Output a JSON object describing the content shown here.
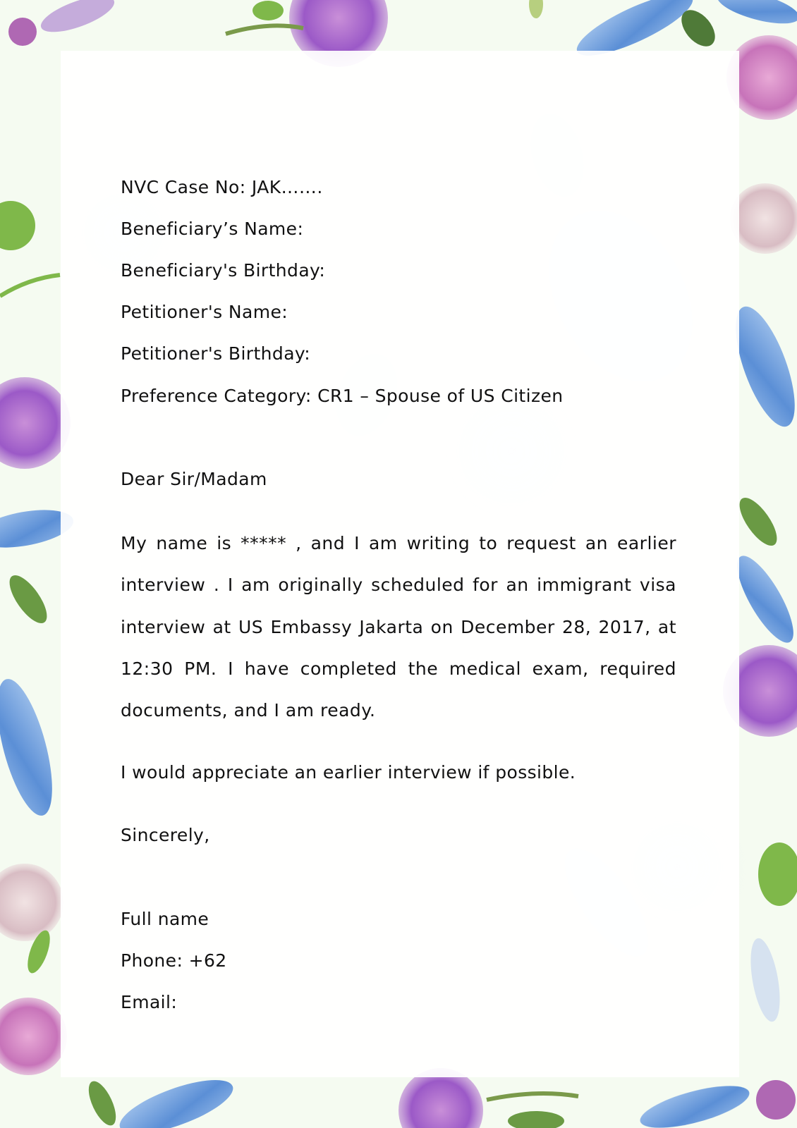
{
  "header": {
    "case_no": "NVC Case No: JAK…….",
    "beneficiary_name": "Beneficiary’s Name:",
    "beneficiary_birthday": "Beneficiary's Birthday:",
    "petitioner_name": "Petitioner's Name:",
    "petitioner_birthday": "Petitioner's Birthday:",
    "preference_category": "Preference Category: CR1 – Spouse of US Citizen"
  },
  "body": {
    "salutation": "Dear Sir/Madam",
    "paragraph_1": "My name is ***** , and I am writing to request an earlier interview . I am originally scheduled for an immigrant visa interview at US Embassy Jakarta on December 28, 2017, at 12:30 PM. I have completed the medical exam, required documents, and I am ready.",
    "paragraph_2": "I would appreciate an earlier interview if possible.",
    "closing": "Sincerely,"
  },
  "signature": {
    "name": "Full name",
    "phone": "Phone: +62",
    "email": "Email:"
  },
  "decoration": {
    "style": "watercolor floral border",
    "colors": [
      "#9b59c7",
      "#c98fd8",
      "#5b8fd6",
      "#7fb84a",
      "#e0c8cf"
    ]
  }
}
